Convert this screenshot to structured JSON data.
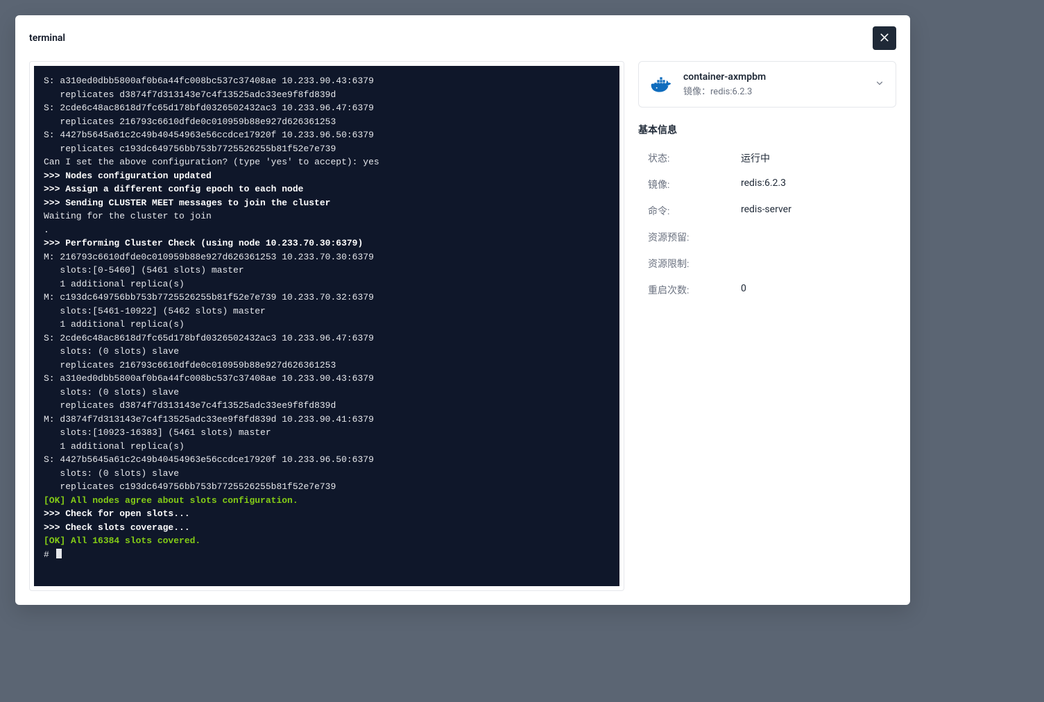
{
  "modal": {
    "title": "terminal"
  },
  "terminal": {
    "lines": [
      {
        "text": "S: a310ed0dbb5800af0b6a44fc008bc537c37408ae 10.233.90.43:6379",
        "style": "plain"
      },
      {
        "text": "   replicates d3874f7d313143e7c4f13525adc33ee9f8fd839d",
        "style": "plain"
      },
      {
        "text": "S: 2cde6c48ac8618d7fc65d178bfd0326502432ac3 10.233.96.47:6379",
        "style": "plain"
      },
      {
        "text": "   replicates 216793c6610dfde0c010959b88e927d626361253",
        "style": "plain"
      },
      {
        "text": "S: 4427b5645a61c2c49b40454963e56ccdce17920f 10.233.96.50:6379",
        "style": "plain"
      },
      {
        "text": "   replicates c193dc649756bb753b7725526255b81f52e7e739",
        "style": "plain"
      },
      {
        "text": "Can I set the above configuration? (type 'yes' to accept): yes",
        "style": "plain"
      },
      {
        "text": ">>> Nodes configuration updated",
        "style": "bold"
      },
      {
        "text": ">>> Assign a different config epoch to each node",
        "style": "bold"
      },
      {
        "text": ">>> Sending CLUSTER MEET messages to join the cluster",
        "style": "bold"
      },
      {
        "text": "Waiting for the cluster to join",
        "style": "plain"
      },
      {
        "text": ".",
        "style": "plain"
      },
      {
        "text": ">>> Performing Cluster Check (using node 10.233.70.30:6379)",
        "style": "bold"
      },
      {
        "text": "M: 216793c6610dfde0c010959b88e927d626361253 10.233.70.30:6379",
        "style": "plain"
      },
      {
        "text": "   slots:[0-5460] (5461 slots) master",
        "style": "plain"
      },
      {
        "text": "   1 additional replica(s)",
        "style": "plain"
      },
      {
        "text": "M: c193dc649756bb753b7725526255b81f52e7e739 10.233.70.32:6379",
        "style": "plain"
      },
      {
        "text": "   slots:[5461-10922] (5462 slots) master",
        "style": "plain"
      },
      {
        "text": "   1 additional replica(s)",
        "style": "plain"
      },
      {
        "text": "S: 2cde6c48ac8618d7fc65d178bfd0326502432ac3 10.233.96.47:6379",
        "style": "plain"
      },
      {
        "text": "   slots: (0 slots) slave",
        "style": "plain"
      },
      {
        "text": "   replicates 216793c6610dfde0c010959b88e927d626361253",
        "style": "plain"
      },
      {
        "text": "S: a310ed0dbb5800af0b6a44fc008bc537c37408ae 10.233.90.43:6379",
        "style": "plain"
      },
      {
        "text": "   slots: (0 slots) slave",
        "style": "plain"
      },
      {
        "text": "   replicates d3874f7d313143e7c4f13525adc33ee9f8fd839d",
        "style": "plain"
      },
      {
        "text": "M: d3874f7d313143e7c4f13525adc33ee9f8fd839d 10.233.90.41:6379",
        "style": "plain"
      },
      {
        "text": "   slots:[10923-16383] (5461 slots) master",
        "style": "plain"
      },
      {
        "text": "   1 additional replica(s)",
        "style": "plain"
      },
      {
        "text": "S: 4427b5645a61c2c49b40454963e56ccdce17920f 10.233.96.50:6379",
        "style": "plain"
      },
      {
        "text": "   slots: (0 slots) slave",
        "style": "plain"
      },
      {
        "text": "   replicates c193dc649756bb753b7725526255b81f52e7e739",
        "style": "plain"
      },
      {
        "text": "[OK] All nodes agree about slots configuration.",
        "style": "ok"
      },
      {
        "text": ">>> Check for open slots...",
        "style": "bold"
      },
      {
        "text": ">>> Check slots coverage...",
        "style": "bold"
      },
      {
        "text": "[OK] All 16384 slots covered.",
        "style": "ok"
      }
    ],
    "prompt": "# "
  },
  "container": {
    "name": "container-axmpbm",
    "subtitle_prefix": "镜像：",
    "subtitle_value": "redis:6.2.3"
  },
  "info": {
    "section_title": "基本信息",
    "rows": [
      {
        "label": "状态:",
        "value": "运行中"
      },
      {
        "label": "镜像:",
        "value": "redis:6.2.3"
      },
      {
        "label": "命令:",
        "value": "redis-server"
      },
      {
        "label": "资源预留:",
        "value": ""
      },
      {
        "label": "资源限制:",
        "value": ""
      },
      {
        "label": "重启次数:",
        "value": "0"
      }
    ]
  }
}
